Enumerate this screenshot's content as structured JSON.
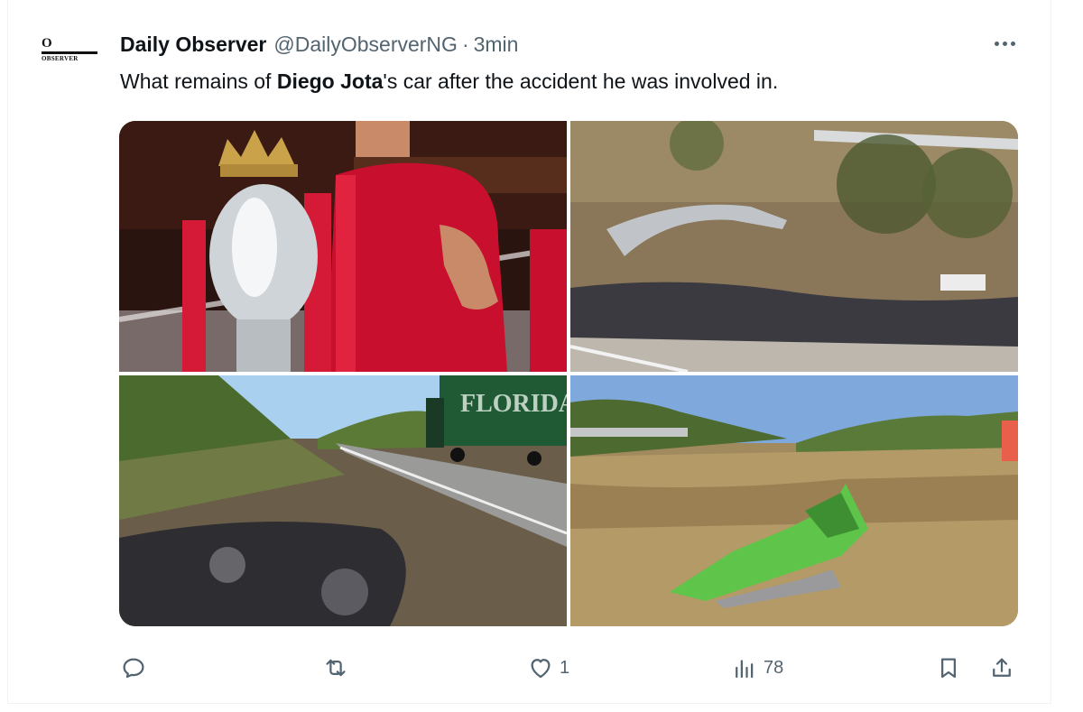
{
  "tweet": {
    "author_name": "Daily Observer",
    "handle": "@DailyObserverNG",
    "separator": "·",
    "time": "3min",
    "text_before": "What remains of ",
    "text_bold": "Diego Jota",
    "text_after": "'s car after the accident he was involved in.",
    "avatar": {
      "logo_letter": "O",
      "logo_text": "OBSERVER"
    },
    "more_icon": "more-dots-icon"
  },
  "media": {
    "images": [
      {
        "description_icon": "photo",
        "label": "Player holding trophy"
      },
      {
        "description_icon": "photo",
        "label": "Crash site guardrail"
      },
      {
        "description_icon": "photo",
        "label": "Burned debris roadside with truck"
      },
      {
        "description_icon": "photo",
        "label": "Green car wreckage"
      }
    ],
    "truck_text": "FLORIDA"
  },
  "actions": {
    "reply": {
      "icon": "reply-icon",
      "count": ""
    },
    "repost": {
      "icon": "repost-icon",
      "count": ""
    },
    "like": {
      "icon": "heart-icon",
      "count": "1"
    },
    "views": {
      "icon": "views-icon",
      "count": "78"
    },
    "bookmark": {
      "icon": "bookmark-icon"
    },
    "share": {
      "icon": "share-icon"
    }
  },
  "colors": {
    "text": "#0f1419",
    "secondary": "#536471",
    "border": "#eff3f4"
  }
}
